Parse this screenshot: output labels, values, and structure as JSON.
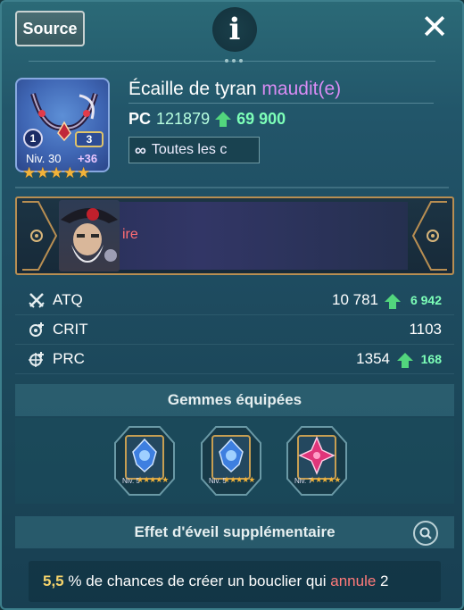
{
  "header": {
    "source_label": "Source",
    "info_label": "i",
    "close_label": "✕"
  },
  "item": {
    "icon": "necklace-icon",
    "enhance_level": "1",
    "upgrade_badge": "3",
    "level_text": "Niv. 30",
    "bonus_text": "+36",
    "stars": "★★★★★",
    "title_main": "Écaille de tyran",
    "title_suffix": "maudit(e)",
    "pc_label": "PC",
    "pc_value": "121879",
    "pc_increase": "69 900",
    "tag_icon": "∞",
    "tag_text": "Toutes les c"
  },
  "banner": {
    "text": "ire"
  },
  "stats": [
    {
      "icon": "swords-icon",
      "label": "ATQ",
      "value": "10 781",
      "increase": "6 942"
    },
    {
      "icon": "crit-icon",
      "label": "CRIT",
      "value": "1103",
      "increase": ""
    },
    {
      "icon": "penetration-icon",
      "label": "PRC",
      "value": "1354",
      "increase": "168"
    }
  ],
  "gems": {
    "title": "Gemmes équipées",
    "items": [
      {
        "name": "blue-gem",
        "level": "Niv. 5",
        "stars": "★★★★★"
      },
      {
        "name": "blue-gem",
        "level": "Niv. 5",
        "stars": "★★★★★"
      },
      {
        "name": "pink-gem",
        "level": "Niv. 7",
        "stars": "★★★★★"
      }
    ]
  },
  "awakening": {
    "title": "Effet d'éveil supplémentaire",
    "value": "5,5",
    "text_before": " % de chances de créer un bouclier qui ",
    "highlight": "annule",
    "text_after": " 2"
  },
  "colors": {
    "accent_green": "#52d67d",
    "cursed_purple": "#d98cf4",
    "banner_red": "#ff6d73",
    "star_gold": "#f2b33a"
  }
}
